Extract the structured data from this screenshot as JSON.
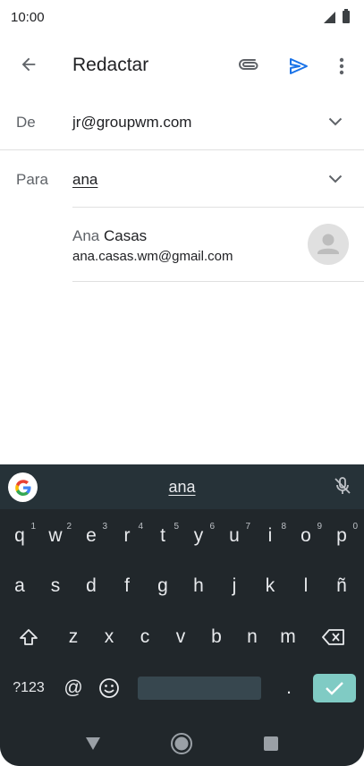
{
  "status_bar": {
    "time": "10:00"
  },
  "app_bar": {
    "title": "Redactar"
  },
  "from_field": {
    "label": "De",
    "value": "jr@groupwm.com"
  },
  "to_field": {
    "label": "Para",
    "value": "ana"
  },
  "suggestion": {
    "first_name": "Ana",
    "last_name": "Casas",
    "email": "ana.casas.wm@gmail.com"
  },
  "keyboard": {
    "suggestion_word": "ana",
    "row1": [
      {
        "key": "q",
        "hint": "1"
      },
      {
        "key": "w",
        "hint": "2"
      },
      {
        "key": "e",
        "hint": "3"
      },
      {
        "key": "r",
        "hint": "4"
      },
      {
        "key": "t",
        "hint": "5"
      },
      {
        "key": "y",
        "hint": "6"
      },
      {
        "key": "u",
        "hint": "7"
      },
      {
        "key": "i",
        "hint": "8"
      },
      {
        "key": "o",
        "hint": "9"
      },
      {
        "key": "p",
        "hint": "0"
      }
    ],
    "row2": [
      "a",
      "s",
      "d",
      "f",
      "g",
      "h",
      "j",
      "k",
      "l",
      "ñ"
    ],
    "row3": [
      "z",
      "x",
      "c",
      "v",
      "b",
      "n",
      "m"
    ],
    "symbols_label": "?123",
    "at_label": "@",
    "period_label": "."
  },
  "colors": {
    "accent": "#1a73e8",
    "keyboard_bg": "#21272b",
    "enter_key": "#80cbc4"
  },
  "icons": {
    "back": "arrow-back-icon",
    "attach": "paperclip-icon",
    "send": "send-icon",
    "more": "more-vert-icon",
    "chevron": "chevron-down-icon",
    "mic": "mic-off-icon",
    "shift": "shift-icon",
    "backspace": "backspace-icon",
    "emoji": "emoji-icon",
    "enter": "check-icon"
  }
}
